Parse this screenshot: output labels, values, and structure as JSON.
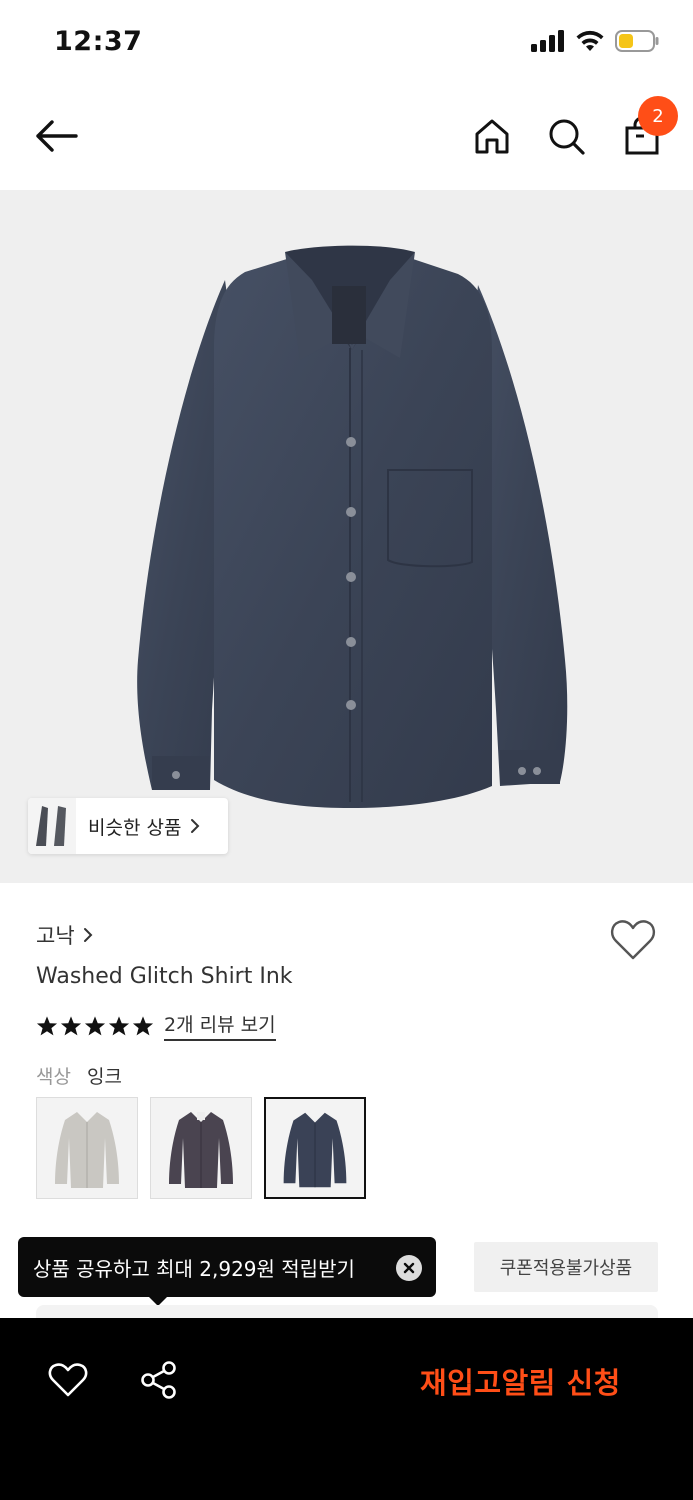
{
  "status_bar": {
    "time": "12:37"
  },
  "nav": {
    "back_icon": "arrow-left-icon",
    "home_icon": "home-icon",
    "search_icon": "search-icon",
    "bag_icon": "shopping-bag-icon",
    "cart_count": "2"
  },
  "gallery": {
    "similar_label": "비슷한 상품"
  },
  "product": {
    "brand": "고낙",
    "name": "Washed Glitch Shirt Ink",
    "rating_stars": 5,
    "review_link": "2개 리뷰 보기",
    "color_label": "색상",
    "color_value": "잉크",
    "swatches": [
      {
        "color": "#c9c7c2",
        "selected": false
      },
      {
        "color": "#4a4450",
        "selected": false
      },
      {
        "color": "#3a4256",
        "selected": true
      }
    ]
  },
  "tooltip": {
    "text": "상품 공유하고 최대 2,929원 적립받기"
  },
  "coupon": {
    "label": "쿠폰적용불가상품"
  },
  "bottom_bar": {
    "cta_label": "재입고알림 신청"
  },
  "colors": {
    "accent": "#ff4e17",
    "shirt": "#3d4556",
    "image_bg": "#efefef"
  }
}
